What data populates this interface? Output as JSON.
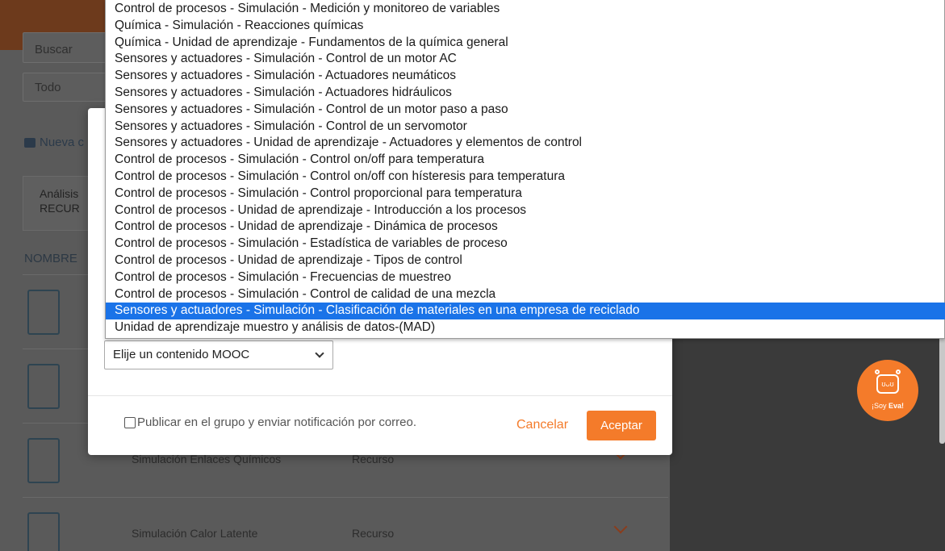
{
  "background": {
    "search_placeholder": "Buscar",
    "filter_value": "Todo",
    "new_folder_label": "Nueva c",
    "card_lines": [
      "Análisis",
      "RECUR"
    ],
    "column_header": "NOMBRE",
    "rows": [
      {
        "name": "",
        "type": ""
      },
      {
        "name": "",
        "type": ""
      },
      {
        "name": "Simulación Enlaces Químicos",
        "type": "Recurso"
      },
      {
        "name": "Simulación Calor Latente",
        "type": "Recurso"
      }
    ]
  },
  "eva": {
    "face": "ʊᴗʊ",
    "text_prefix": "¡Soy ",
    "text_name": "Eva!"
  },
  "modal": {
    "select_value": "Elije un contenido MOOC",
    "publish_label": "Publicar en el grupo y enviar notificación por correo.",
    "cancel_label": "Cancelar",
    "accept_label": "Aceptar"
  },
  "dropdown": {
    "selected_index": 18,
    "options": [
      "Control de procesos - Simulación - Medición y monitoreo de variables",
      "Química - Simulación - Reacciones químicas",
      "Química - Unidad de aprendizaje - Fundamentos de la química general",
      "Sensores y actuadores - Simulación - Control de un motor AC",
      "Sensores y actuadores - Simulación - Actuadores neumáticos",
      "Sensores y actuadores - Simulación - Actuadores hidráulicos",
      "Sensores y actuadores - Simulación - Control de un motor paso a paso",
      "Sensores y actuadores - Simulación - Control de un servomotor",
      "Sensores y actuadores - Unidad de aprendizaje - Actuadores y elementos de control",
      "Control de procesos - Simulación - Control on/off para temperatura",
      "Control de procesos - Simulación - Control on/off con hísteresis para temperatura",
      "Control de procesos - Simulación - Control proporcional para temperatura",
      "Control de procesos - Unidad de aprendizaje - Introducción a los procesos",
      "Control de procesos - Unidad de aprendizaje - Dinámica de procesos",
      "Control de procesos - Simulación - Estadística de variables de proceso",
      "Control de procesos - Unidad de aprendizaje - Tipos de control",
      "Control de procesos - Simulación - Frecuencias de muestreo",
      "Control de procesos - Simulación - Control de calidad de una mezcla",
      "Sensores y actuadores - Simulación - Clasificación de materiales en una empresa de reciclado",
      "Unidad de aprendizaje muestro y análisis de datos-(MAD)"
    ]
  },
  "colors": {
    "accent": "#f47b2a",
    "selection": "#1a73e8"
  }
}
